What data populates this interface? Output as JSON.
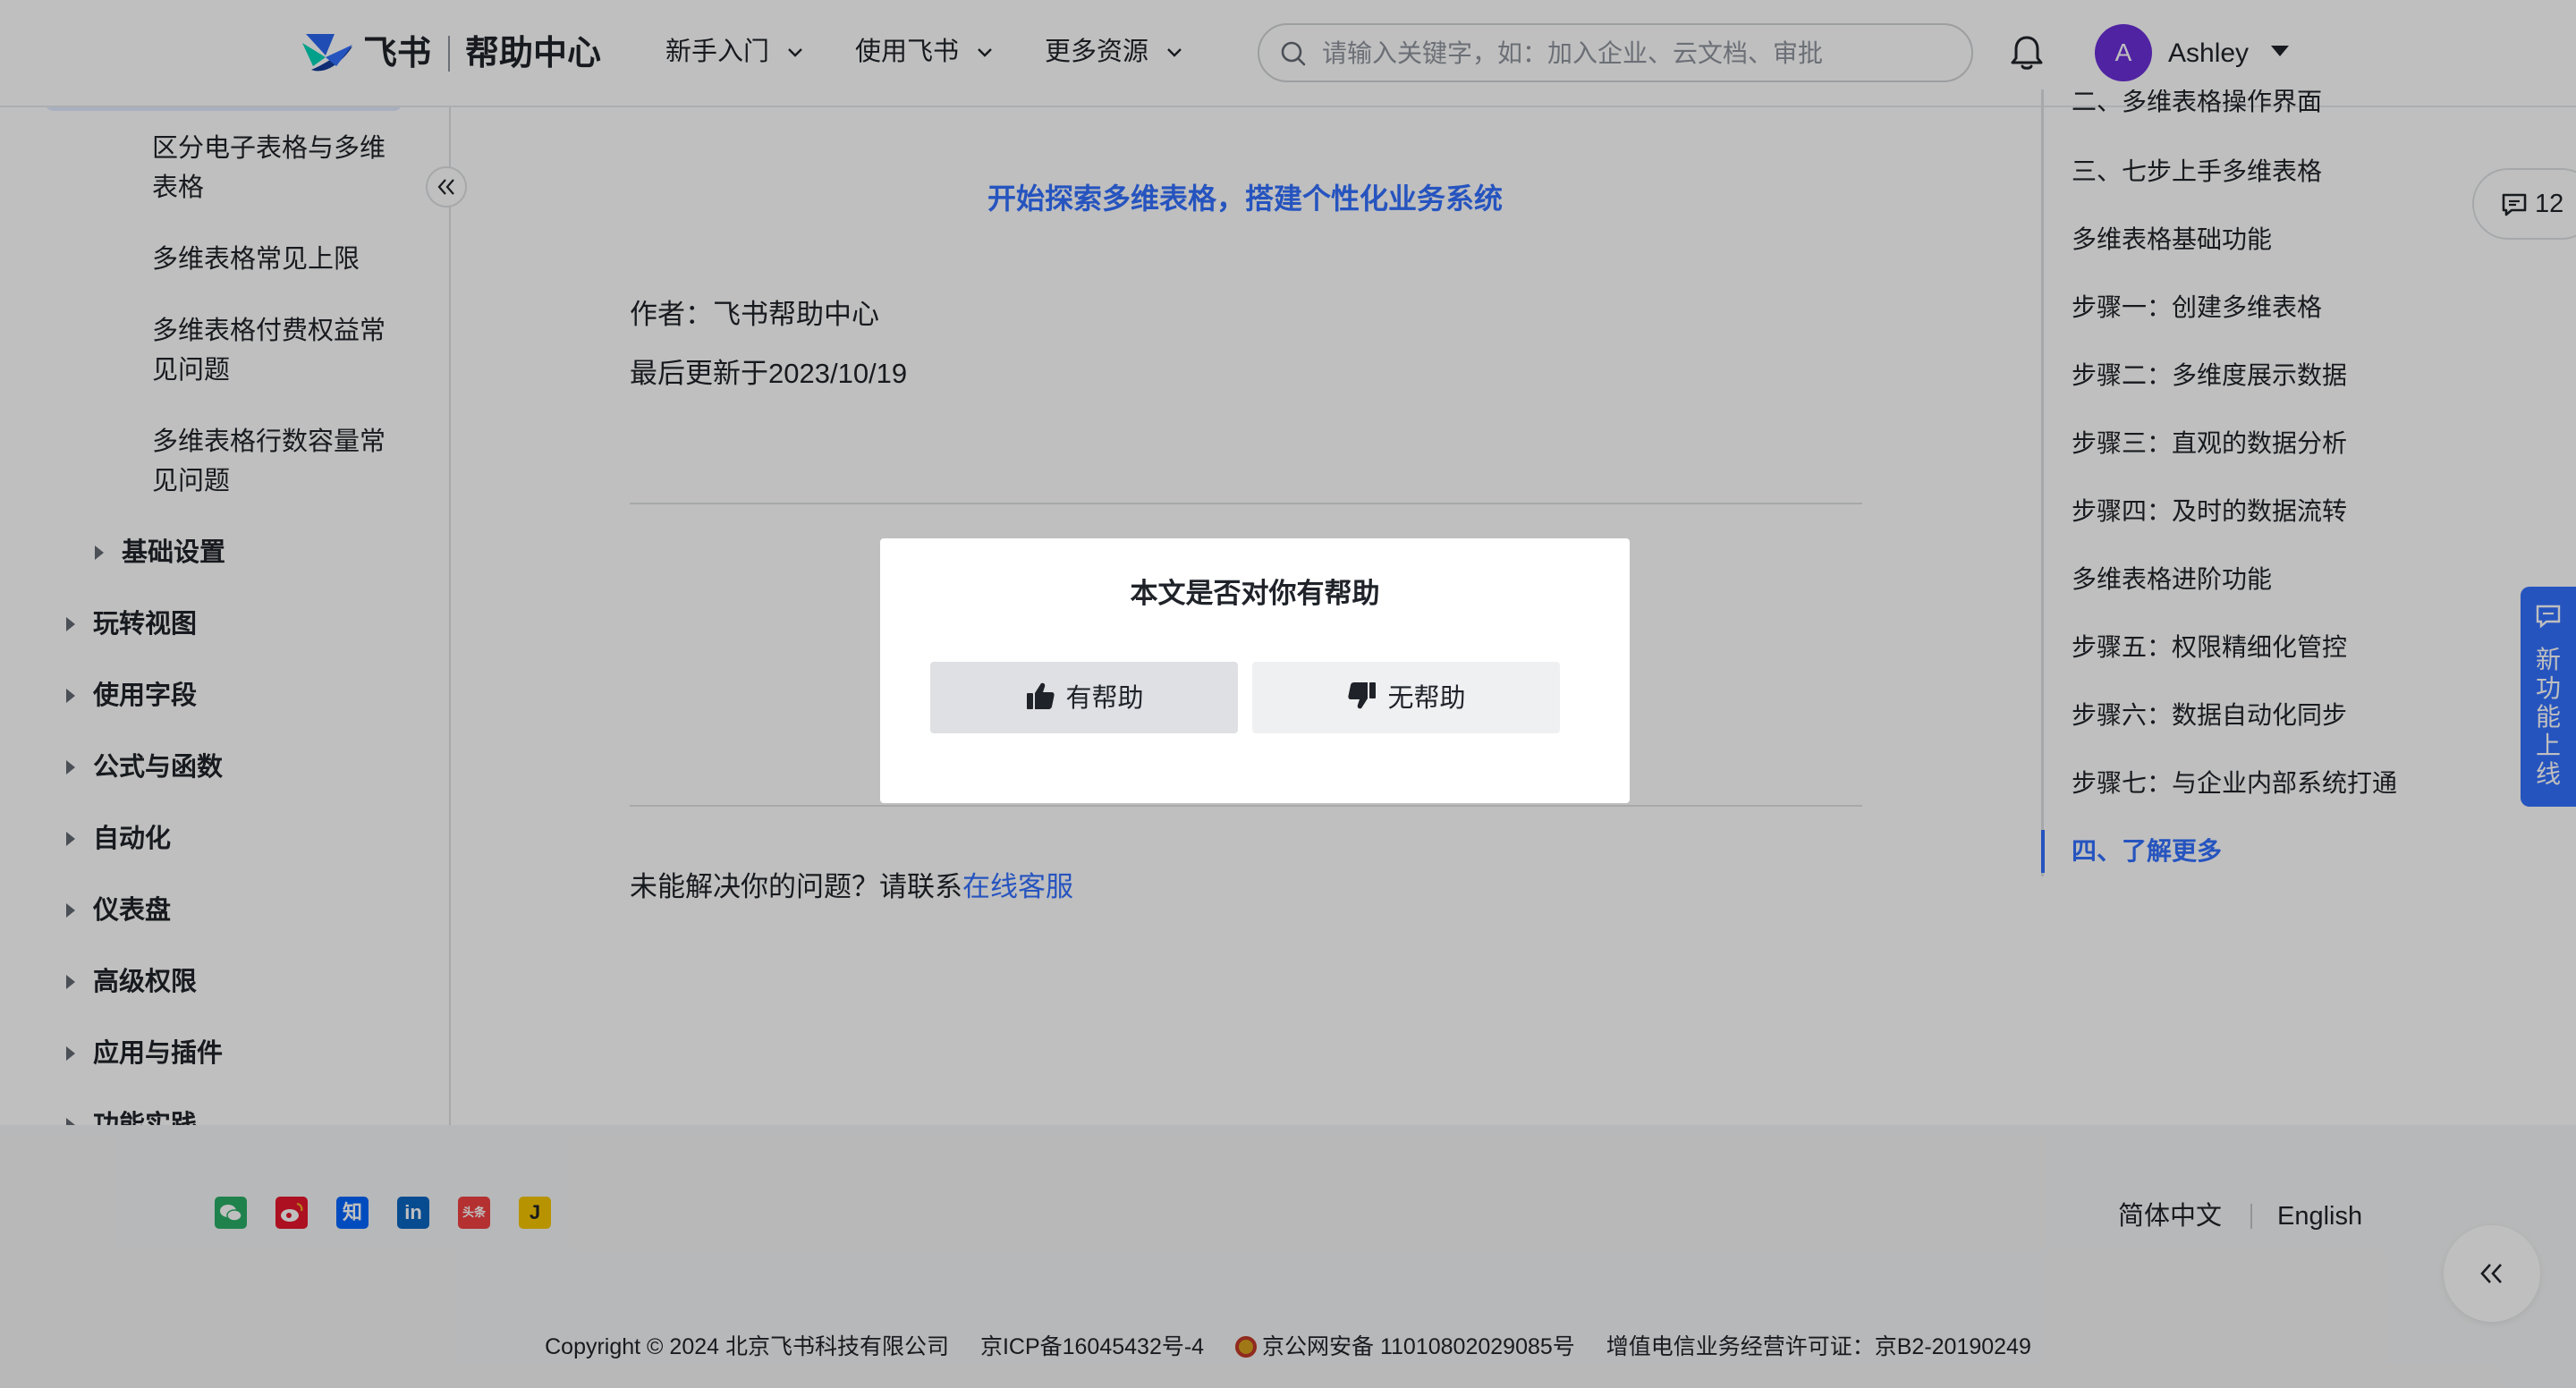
{
  "header": {
    "brand": "飞书",
    "section": "帮助中心",
    "nav": [
      {
        "label": "新手入门"
      },
      {
        "label": "使用飞书"
      },
      {
        "label": "更多资源"
      }
    ],
    "search_placeholder": "请输入关键字，如：加入企业、云文档、审批",
    "user": {
      "initial": "A",
      "name": "Ashley"
    }
  },
  "sidebar": {
    "sub_items": [
      "区分电子表格与多维表格",
      "多维表格常见上限",
      "多维表格付费权益常见问题",
      "多维表格行数容量常见问题"
    ],
    "nested_section": "基础设置",
    "sections": [
      "玩转视图",
      "使用字段",
      "公式与函数",
      "自动化",
      "仪表盘",
      "高级权限",
      "应用与插件",
      "功能实践"
    ]
  },
  "main": {
    "cta_link": "开始探索多维表格，搭建个性化业务系统",
    "author": "作者：飞书帮助中心",
    "updated": "最后更新于2023/10/19",
    "help_prefix": "未能解决你的问题？请联系",
    "help_link": "在线客服"
  },
  "toc": {
    "items": [
      "二、多维表格操作界面",
      "三、七步上手多维表格",
      "多维表格基础功能",
      "步骤一：创建多维表格",
      "步骤二：多维度展示数据",
      "步骤三：直观的数据分析",
      "步骤四：及时的数据流转",
      "多维表格进阶功能",
      "步骤五：权限精细化管控",
      "步骤六：数据自动化同步",
      "步骤七：与企业内部系统打通",
      "四、了解更多"
    ],
    "active_index": 11
  },
  "comment_count": "12",
  "feature_tab": "新功能上线",
  "modal": {
    "title": "本文是否对你有帮助",
    "yes_label": "有帮助",
    "no_label": "无帮助"
  },
  "footer": {
    "social": [
      {
        "icon": "wechat-icon",
        "color": "#2aae67"
      },
      {
        "icon": "weibo-icon",
        "color": "#e6162d"
      },
      {
        "icon": "zhihu-icon",
        "color": "#0066ff",
        "text": "知"
      },
      {
        "icon": "linkedin-icon",
        "color": "#0a66c2",
        "text": "in"
      },
      {
        "icon": "toutiao-icon",
        "color": "#f04142",
        "text": "头条"
      },
      {
        "icon": "jinri-icon",
        "color": "#f5c400",
        "text": "J"
      }
    ],
    "lang_zh": "简体中文",
    "lang_en": "English",
    "copyright": "Copyright © 2024 北京飞书科技有限公司",
    "icp": "京ICP备16045432号-4",
    "police": "京公网安备 11010802029085号",
    "license": "增值电信业务经营许可证：京B2-20190249"
  },
  "colors": {
    "accent": "#3370ff",
    "overlay": "rgba(0,0,0,0.25)"
  }
}
